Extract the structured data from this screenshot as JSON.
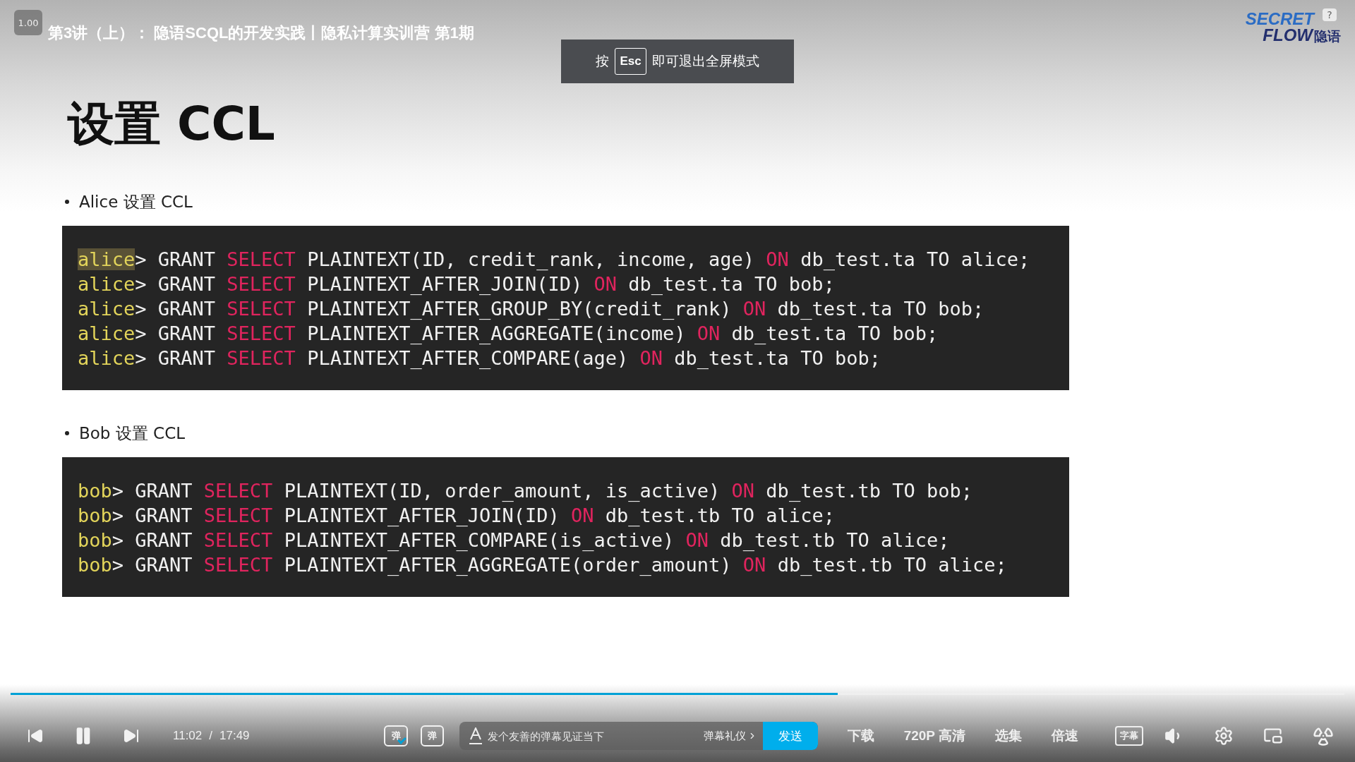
{
  "player": {
    "title": "第3讲（上）： 隐语SCQL的开发实践丨隐私计算实训营 第1期",
    "speed_badge": "1.00",
    "toast": {
      "before": "按",
      "key": "Esc",
      "after": "即可退出全屏模式"
    },
    "logo": {
      "top": "SECRET",
      "bottom": "FLOW",
      "cn": "隐语",
      "help": "?"
    }
  },
  "slide": {
    "heading": "设置 CCL",
    "sections": [
      {
        "bullet": "Alice 设置 CCL",
        "lines": [
          [
            {
              "kind": "prompt",
              "text": "alice",
              "highlighted": true
            },
            {
              "kind": "plain",
              "text": "> GRANT "
            },
            {
              "kind": "keyword",
              "text": "SELECT"
            },
            {
              "kind": "plain",
              "text": " PLAINTEXT(ID, credit_rank, income, age) "
            },
            {
              "kind": "keyword",
              "text": "ON"
            },
            {
              "kind": "plain",
              "text": " db_test.ta TO alice;"
            }
          ],
          [
            {
              "kind": "prompt",
              "text": "alice",
              "highlighted": false
            },
            {
              "kind": "plain",
              "text": "> GRANT "
            },
            {
              "kind": "keyword",
              "text": "SELECT"
            },
            {
              "kind": "plain",
              "text": " PLAINTEXT_AFTER_JOIN(ID) "
            },
            {
              "kind": "keyword",
              "text": "ON"
            },
            {
              "kind": "plain",
              "text": " db_test.ta TO bob;"
            }
          ],
          [
            {
              "kind": "prompt",
              "text": "alice",
              "highlighted": false
            },
            {
              "kind": "plain",
              "text": "> GRANT "
            },
            {
              "kind": "keyword",
              "text": "SELECT"
            },
            {
              "kind": "plain",
              "text": " PLAINTEXT_AFTER_GROUP_BY(credit_rank) "
            },
            {
              "kind": "keyword",
              "text": "ON"
            },
            {
              "kind": "plain",
              "text": " db_test.ta TO bob;"
            }
          ],
          [
            {
              "kind": "prompt",
              "text": "alice",
              "highlighted": false
            },
            {
              "kind": "plain",
              "text": "> GRANT "
            },
            {
              "kind": "keyword",
              "text": "SELECT"
            },
            {
              "kind": "plain",
              "text": " PLAINTEXT_AFTER_AGGREGATE(income) "
            },
            {
              "kind": "keyword",
              "text": "ON"
            },
            {
              "kind": "plain",
              "text": " db_test.ta TO bob;"
            }
          ],
          [
            {
              "kind": "prompt",
              "text": "alice",
              "highlighted": false
            },
            {
              "kind": "plain",
              "text": "> GRANT "
            },
            {
              "kind": "keyword",
              "text": "SELECT"
            },
            {
              "kind": "plain",
              "text": " PLAINTEXT_AFTER_COMPARE(age) "
            },
            {
              "kind": "keyword",
              "text": "ON"
            },
            {
              "kind": "plain",
              "text": " db_test.ta TO bob;"
            }
          ]
        ]
      },
      {
        "bullet": "Bob 设置 CCL",
        "lines": [
          [
            {
              "kind": "prompt",
              "text": "bob",
              "highlighted": false
            },
            {
              "kind": "plain",
              "text": "> GRANT "
            },
            {
              "kind": "keyword",
              "text": "SELECT"
            },
            {
              "kind": "plain",
              "text": " PLAINTEXT(ID, order_amount, is_active) "
            },
            {
              "kind": "keyword",
              "text": "ON"
            },
            {
              "kind": "plain",
              "text": " db_test.tb TO bob;"
            }
          ],
          [
            {
              "kind": "prompt",
              "text": "bob",
              "highlighted": false
            },
            {
              "kind": "plain",
              "text": "> GRANT "
            },
            {
              "kind": "keyword",
              "text": "SELECT"
            },
            {
              "kind": "plain",
              "text": " PLAINTEXT_AFTER_JOIN(ID) "
            },
            {
              "kind": "keyword",
              "text": "ON"
            },
            {
              "kind": "plain",
              "text": " db_test.tb TO alice;"
            }
          ],
          [
            {
              "kind": "prompt",
              "text": "bob",
              "highlighted": false
            },
            {
              "kind": "plain",
              "text": "> GRANT "
            },
            {
              "kind": "keyword",
              "text": "SELECT"
            },
            {
              "kind": "plain",
              "text": " PLAINTEXT_AFTER_COMPARE(is_active) "
            },
            {
              "kind": "keyword",
              "text": "ON"
            },
            {
              "kind": "plain",
              "text": " db_test.tb TO alice;"
            }
          ],
          [
            {
              "kind": "prompt",
              "text": "bob",
              "highlighted": false
            },
            {
              "kind": "plain",
              "text": "> GRANT "
            },
            {
              "kind": "keyword",
              "text": "SELECT"
            },
            {
              "kind": "plain",
              "text": " PLAINTEXT_AFTER_AGGREGATE(order_amount) "
            },
            {
              "kind": "keyword",
              "text": "ON"
            },
            {
              "kind": "plain",
              "text": " db_test.tb TO alice;"
            }
          ]
        ]
      }
    ]
  },
  "controls": {
    "progress": {
      "level": 0.62
    },
    "current_time": "11:02",
    "separator": "/",
    "total_time": "17:49",
    "danmaku_toggle": {
      "glyph": "弹",
      "on": true
    },
    "danmaku_settings": {
      "glyph": "弹"
    },
    "danmaku_input": {
      "placeholder": "发个友善的弹幕见证当下",
      "etiquette": "弹幕礼仪",
      "send": "发送"
    },
    "menu": [
      "下载",
      "720P 高清",
      "选集",
      "倍速"
    ],
    "subtitles": {
      "glyph": "字幕",
      "on": false
    }
  }
}
